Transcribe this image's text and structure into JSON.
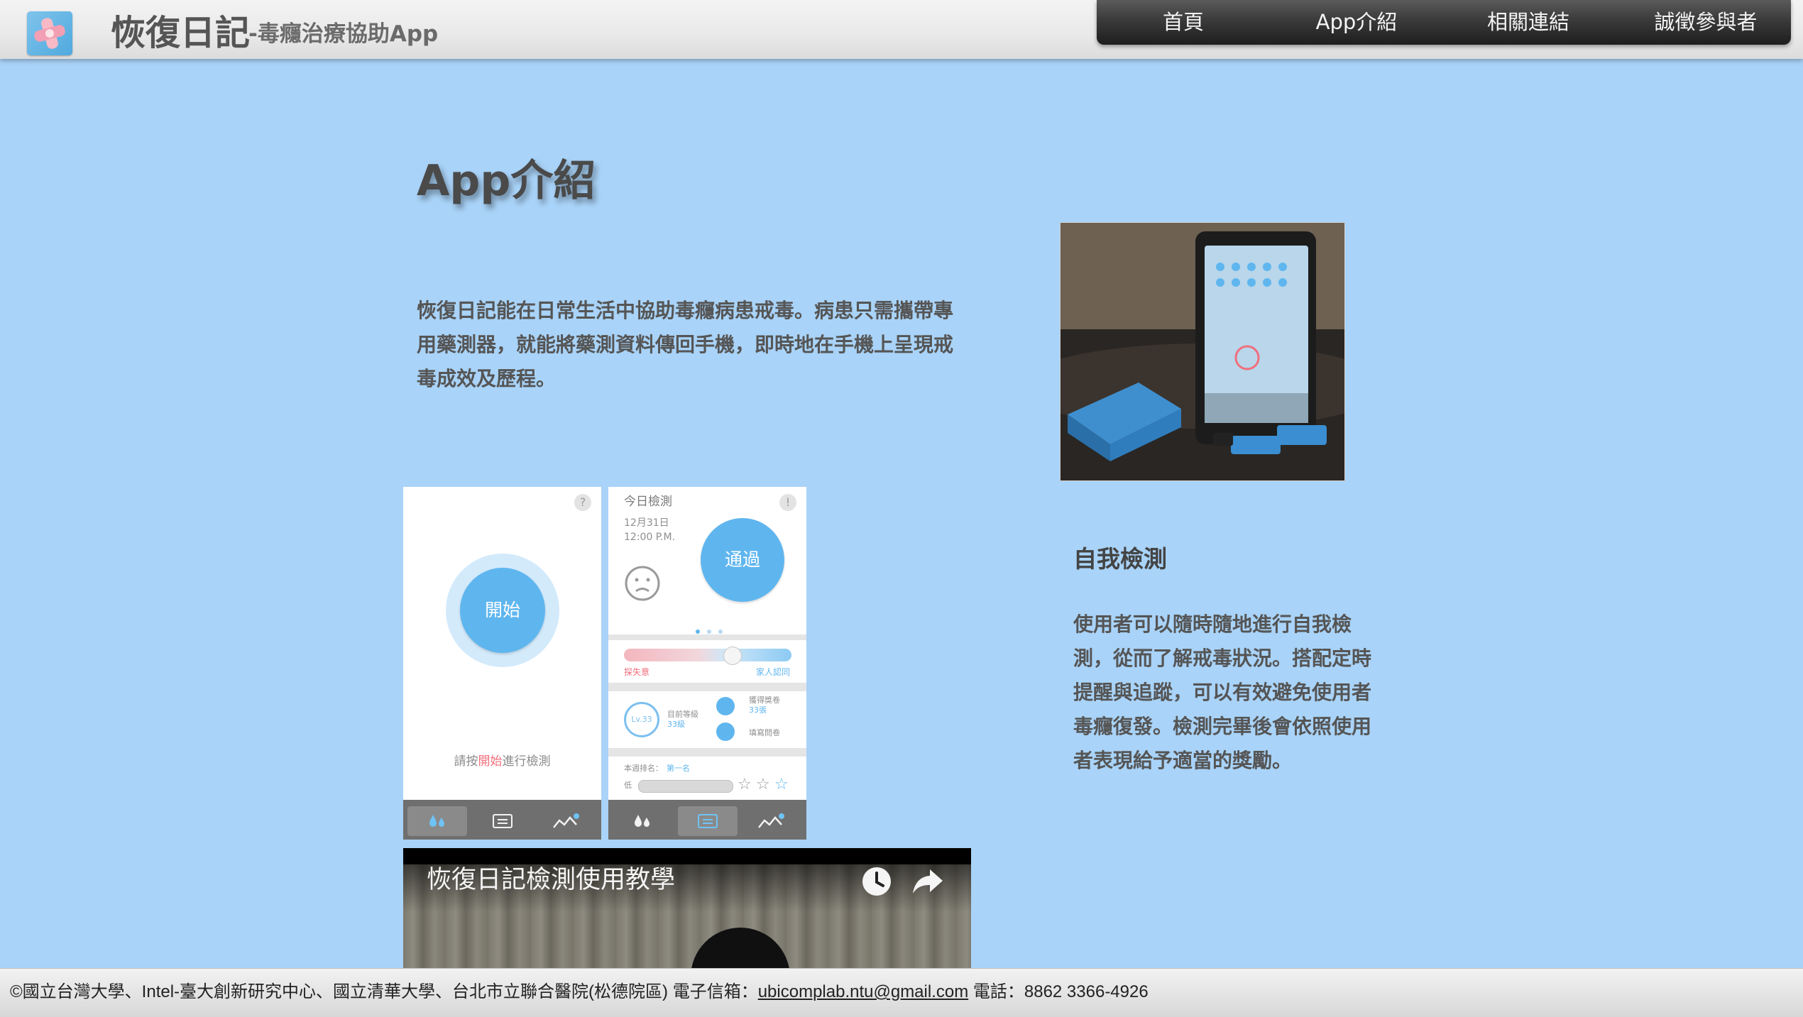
{
  "header": {
    "title": "恢復日記",
    "subtitle": "-毒癮治療協助App",
    "nav": [
      {
        "label": "首頁"
      },
      {
        "label": "App介紹"
      },
      {
        "label": "相關連結"
      },
      {
        "label": "誠徵參與者"
      }
    ]
  },
  "main": {
    "heading": "App介紹",
    "intro": "恢復日記能在日常生活中協助毒癮病患戒毒。病患只需攜帶專用藥測器，就能將藥測資料傳回手機，即時地在手機上呈現戒毒成效及歷程。",
    "feature": {
      "title": "自我檢測",
      "text": "使用者可以隨時隨地進行自我檢測，從而了解戒毒狀況。搭配定時提醒與追蹤，可以有效避免使用者毒癮復發。檢測完畢後會依照使用者表現給予適當的獎勵。"
    },
    "phone_left": {
      "help": "?",
      "start": "開始",
      "hint_prefix": "請按",
      "hint_accent": "開始",
      "hint_suffix": "進行檢測"
    },
    "phone_right": {
      "title": "今日檢測",
      "help": "!",
      "date": "12月31日",
      "time": "12:00 P.M.",
      "pass": "通過",
      "slider_left": "探失意",
      "slider_right": "家人認同",
      "level": "Lv.33",
      "level_label": "目前等級",
      "level_value": "33級",
      "reward_label": "獲得獎卷",
      "reward_value": "33張",
      "survey_label": "填寫問卷",
      "rank_label": "本週排名：",
      "rank_value": "第一名",
      "rank_low": "低"
    },
    "video": {
      "title": "恢復日記檢測使用教學"
    }
  },
  "footer": {
    "text": "©國立台灣大學、Intel-臺大創新研究中心、國立清華大學、台北市立聯合醫院(松德院區)  電子信箱：",
    "email": "ubicomplab.ntu@gmail.com",
    "phone": "  電話：8862 3366-4926"
  },
  "colors": {
    "background": "#a9d3f8",
    "accent_blue": "#5fb6ef",
    "accent_pink": "#f06f7d",
    "nav_bg": "#2b2b2b"
  }
}
